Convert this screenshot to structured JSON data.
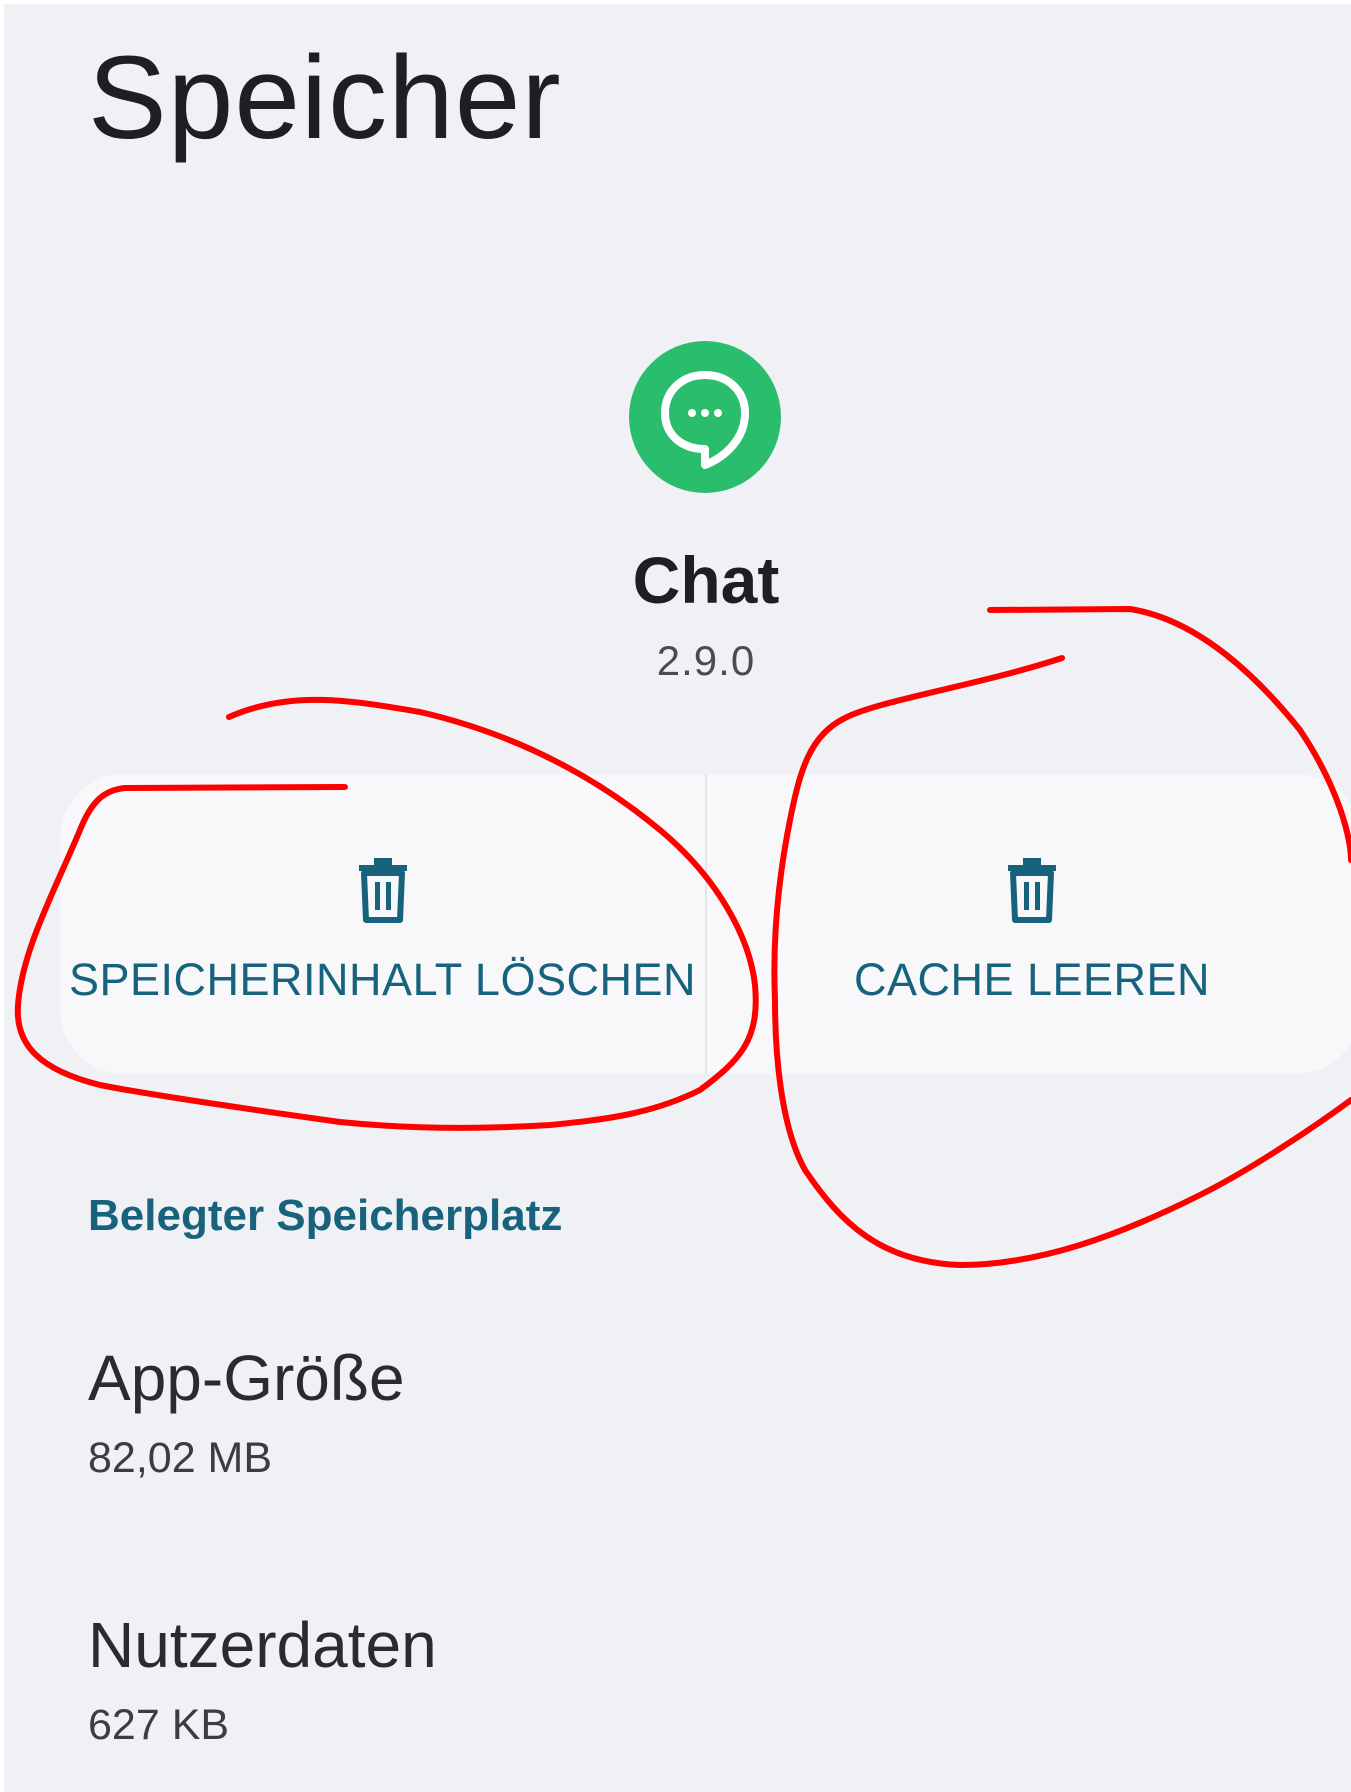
{
  "page": {
    "title": "Speicher"
  },
  "app": {
    "name": "Chat",
    "version": "2.9.0",
    "icon": "chat-bubble-icon",
    "icon_color": "#2bbd6e"
  },
  "actions": {
    "clear_storage_label": "SPEICHERINHALT LÖSCHEN",
    "clear_cache_label": "CACHE LEEREN",
    "icon": "trash-icon",
    "accent_color": "#17637e"
  },
  "storage": {
    "section_title": "Belegter Speicherplatz",
    "items": [
      {
        "label": "App-Größe",
        "value": "82,02 MB"
      },
      {
        "label": "Nutzerdaten",
        "value": "627 KB"
      }
    ]
  },
  "annotation": {
    "color": "#ff0000",
    "shape": "hand-drawn-circles"
  }
}
